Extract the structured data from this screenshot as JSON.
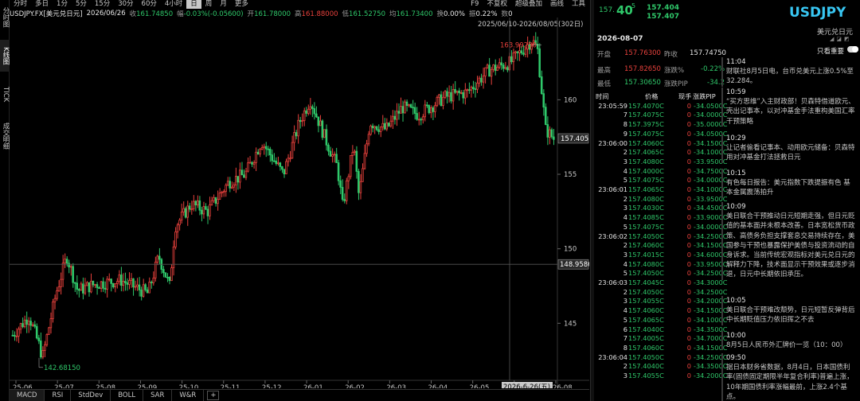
{
  "left_rail": [
    {
      "label": "分时图",
      "active": false
    },
    {
      "label": "K线图",
      "active": true
    },
    {
      "label": "TICK",
      "active": false
    },
    {
      "label": "成交明细",
      "active": false
    }
  ],
  "toolbar": {
    "periods": [
      "分时",
      "多日",
      "1分",
      "5分",
      "15分",
      "30分",
      "60分",
      "4小时",
      "日",
      "周",
      "月",
      "更多"
    ],
    "active_period": "日",
    "right": [
      "F9",
      "不复权",
      "超级叠加",
      "画线",
      "工具"
    ]
  },
  "info": {
    "symbol": "USDJPY.FX[美元兑日元]",
    "date": "2026/06/26",
    "last_label": "收",
    "last": "161.74850",
    "chg_label": "幅",
    "chg": "-0.03%(-0.05600)",
    "open_label": "开",
    "open": "161.78000",
    "high_label": "高",
    "high": "161.88000",
    "low_label": "低",
    "low": "161.52750",
    "avg_label": "均",
    "avg": "161.73400",
    "turn_label": "换",
    "turn": "0.00%",
    "amp_label": "振",
    "amp": "0.22%",
    "vol_label": "数",
    "vol": "0"
  },
  "range_label": "2025/06/10-2026/08/05(302日)",
  "chart_data": {
    "type": "candlestick",
    "x_labels": [
      "25-06",
      "25-07",
      "25-08",
      "25-09",
      "25-10",
      "25-11",
      "25-12",
      "26-01",
      "26-02",
      "26-03",
      "26-04",
      "26-05",
      "26-06",
      "26-08"
    ],
    "y_ticks": [
      145,
      150,
      155,
      160
    ],
    "ylim": [
      141.6,
      165.2
    ],
    "max_label": "163.99250",
    "min_label": "142.68150",
    "last_price": "157.405",
    "crosshair_price": "148.9586",
    "crosshair_date": "2026-6-26(五)"
  },
  "bottom_tabs": [
    "MACD",
    "RSI",
    "StdDev",
    "BOLL",
    "SAR",
    "W&R"
  ],
  "quote": {
    "price_main": "157.40",
    "price_sub": "5",
    "bid": "157.404",
    "ask": "157.407"
  },
  "symbol": {
    "code": "USDJPY",
    "name": "美元兑日元"
  },
  "day": {
    "date": "2026-08-07",
    "open_label": "开盘",
    "open": "157.76300",
    "prev_label": "昨收",
    "prev": "157.74750",
    "high_label": "最高",
    "high": "157.82650",
    "chg_pct_label": "涨跌%",
    "chg_pct": "-0.22%",
    "low_label": "最低",
    "low": "157.30650",
    "pip_label": "涨跌PIP",
    "pip": "-34.2"
  },
  "tick_header": {
    "time": "时间",
    "price": "价格",
    "vol": "现手",
    "pip": "涨跌PIP"
  },
  "ticks": [
    {
      "t": "23:05:59",
      "p": "157.4070C",
      "v": "0",
      "d": "-34.0500C"
    },
    {
      "t": "7",
      "p": "157.4075C",
      "v": "0",
      "d": "-34.0000C"
    },
    {
      "t": "8",
      "p": "157.3975C",
      "v": "0",
      "d": "-35.0000C"
    },
    {
      "t": "9",
      "p": "157.4075C",
      "v": "0",
      "d": "-34.0500C"
    },
    {
      "t": "23:06:00",
      "p": "157.4060C",
      "v": "0",
      "d": "-34.1500C"
    },
    {
      "t": "2",
      "p": "157.4065C",
      "v": "0",
      "d": "-34.1000C"
    },
    {
      "t": "3",
      "p": "157.4080C",
      "v": "0",
      "d": "-33.9500C"
    },
    {
      "t": "4",
      "p": "157.4000C",
      "v": "0",
      "d": "-34.7500C"
    },
    {
      "t": "5",
      "p": "157.4075C",
      "v": "0",
      "d": "-34.0000C"
    },
    {
      "t": "23:06:01",
      "p": "157.4065C",
      "v": "0",
      "d": "-34.1000C"
    },
    {
      "t": "2",
      "p": "157.4080C",
      "v": "0",
      "d": "-33.9500C"
    },
    {
      "t": "3",
      "p": "157.4030C",
      "v": "0",
      "d": "-34.4500C"
    },
    {
      "t": "4",
      "p": "157.4085C",
      "v": "0",
      "d": "-33.9000C"
    },
    {
      "t": "5",
      "p": "157.4075C",
      "v": "0",
      "d": "-34.0000C"
    },
    {
      "t": "23:06:02",
      "p": "157.4050C",
      "v": "0",
      "d": "-34.2500C"
    },
    {
      "t": "2",
      "p": "157.4060C",
      "v": "0",
      "d": "-34.1500C"
    },
    {
      "t": "3",
      "p": "157.4015C",
      "v": "0",
      "d": "-34.6000C"
    },
    {
      "t": "4",
      "p": "157.4080C",
      "v": "0",
      "d": "-33.9500C"
    },
    {
      "t": "5",
      "p": "157.4050C",
      "v": "0",
      "d": "-34.2500C"
    },
    {
      "t": "23:06:03",
      "p": "157.4045C",
      "v": "0",
      "d": "-34.3000C"
    },
    {
      "t": "2",
      "p": "157.4050C",
      "v": "0",
      "d": "-34.2500C"
    },
    {
      "t": "3",
      "p": "157.4055C",
      "v": "0",
      "d": "-34.2000C"
    },
    {
      "t": "4",
      "p": "157.4060C",
      "v": "0",
      "d": "-34.1500C"
    },
    {
      "t": "5",
      "p": "157.4065C",
      "v": "0",
      "d": "-34.1000C"
    },
    {
      "t": "6",
      "p": "157.4040C",
      "v": "0",
      "d": "-34.3500C"
    },
    {
      "t": "7",
      "p": "157.4005C",
      "v": "0",
      "d": "-34.7000C"
    },
    {
      "t": "8",
      "p": "157.4060C",
      "v": "0",
      "d": "-34.1500C"
    },
    {
      "t": "23:06:04",
      "p": "157.4050C",
      "v": "0",
      "d": "-34.2500C"
    },
    {
      "t": "2",
      "p": "157.4040C",
      "v": "0",
      "d": "-34.3500C"
    },
    {
      "t": "3",
      "p": "157.4055C",
      "v": "0",
      "d": "-34.2000C"
    }
  ],
  "news_toggle_label": "只看重要",
  "news": [
    {
      "time": "11:04",
      "text": "财联社8月5日电，台币兑美元上涨0.5%至32.284。"
    },
    {
      "time": "10:59",
      "text": "“买方思维”入主财政部！贝森特借道欧元、壳出记事本，以对冲基金手法重构美国汇率干预策略"
    },
    {
      "time": "10:29",
      "text": "让记者偷看记事本、动用欧元储备：贝森特用对冲基金打法拯救日元"
    },
    {
      "time": "10:15",
      "text": "有色每日报告：美元指数下跌提振有色 基本金属震荡拍升"
    },
    {
      "time": "10:09",
      "text": "美日联合干预推动日元短期走强，但日元贬值的基本面并未根本改善。日本宽松货币政策、高债务负担支撑套息交易持续存在，美国参与干预也暴露保护美债与投资流动的自身诉求。当前传统宏观指标对美元兑日元的解释力下降，技术面显示干预效果或逐步消退，日元中长期依旧承压。"
    },
    {
      "time": "10:05",
      "text": "美日联合干预难改颓势，日元短暂反弹背后中长期贬值压力依旧挥之不去"
    },
    {
      "time": "10:00",
      "text": "8月5日人民币外汇牌价一览（10：00）"
    },
    {
      "time": "09:50",
      "text": "据日本财务省数据，8月4日，日本国债利率(固债固定期限半年复合利率)普遍上涨，10年期国债利率涨幅最前，上涨2.4个基点。"
    }
  ]
}
